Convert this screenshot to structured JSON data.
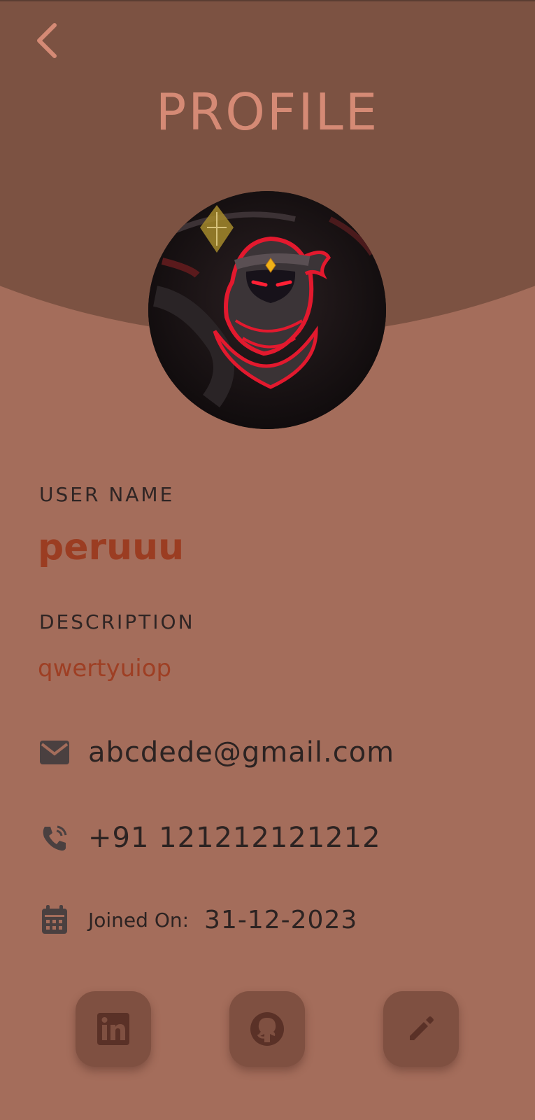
{
  "header": {
    "title": "PROFILE",
    "back_icon": "chevron-left-icon"
  },
  "profile": {
    "avatar_icon": "ninja-avatar",
    "username_label": "USER NAME",
    "username": "peruuu",
    "description_label": "DESCRIPTION",
    "description": "qwertyuiop",
    "email": "abcdede@gmail.com",
    "phone": "+91 121212121212",
    "joined_label": "Joined On:",
    "joined_date": "31-12-2023"
  },
  "actions": [
    {
      "icon": "linkedin-icon"
    },
    {
      "icon": "github-icon"
    },
    {
      "icon": "edit-pencil-icon"
    }
  ],
  "colors": {
    "background": "#a46d5b",
    "header_band": "#7c5242",
    "title": "#d58a75",
    "accent_text": "#9b3d22",
    "button": "#7f5041"
  }
}
